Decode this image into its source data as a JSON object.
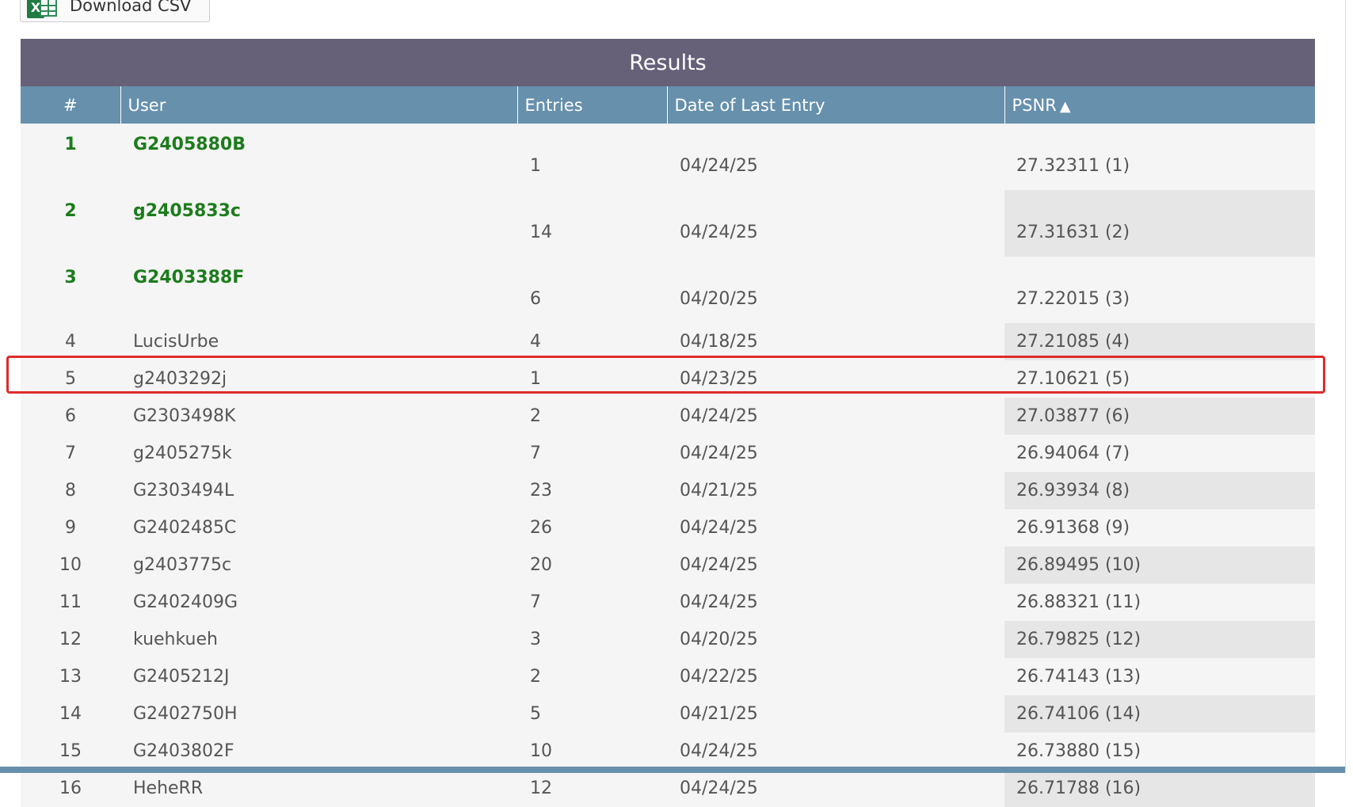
{
  "toolbar": {
    "download_label": "Download CSV"
  },
  "results": {
    "title": "Results",
    "columns": [
      "#",
      "User",
      "Entries",
      "Date of Last Entry",
      "PSNR"
    ],
    "sort_indicator": "▲",
    "rows": [
      {
        "rank": "1",
        "user": "G2405880B",
        "entries": "1",
        "date": "04/24/25",
        "psnr": "27.32311 (1)"
      },
      {
        "rank": "2",
        "user": "g2405833c",
        "entries": "14",
        "date": "04/24/25",
        "psnr": "27.31631 (2)"
      },
      {
        "rank": "3",
        "user": "G2403388F",
        "entries": "6",
        "date": "04/20/25",
        "psnr": "27.22015 (3)"
      },
      {
        "rank": "4",
        "user": "LucisUrbe",
        "entries": "4",
        "date": "04/18/25",
        "psnr": "27.21085 (4)"
      },
      {
        "rank": "5",
        "user": "g2403292j",
        "entries": "1",
        "date": "04/23/25",
        "psnr": "27.10621 (5)"
      },
      {
        "rank": "6",
        "user": "G2303498K",
        "entries": "2",
        "date": "04/24/25",
        "psnr": "27.03877 (6)"
      },
      {
        "rank": "7",
        "user": "g2405275k",
        "entries": "7",
        "date": "04/24/25",
        "psnr": "26.94064 (7)"
      },
      {
        "rank": "8",
        "user": "G2303494L",
        "entries": "23",
        "date": "04/21/25",
        "psnr": "26.93934 (8)"
      },
      {
        "rank": "9",
        "user": "G2402485C",
        "entries": "26",
        "date": "04/24/25",
        "psnr": "26.91368 (9)"
      },
      {
        "rank": "10",
        "user": "g2403775c",
        "entries": "20",
        "date": "04/24/25",
        "psnr": "26.89495 (10)"
      },
      {
        "rank": "11",
        "user": "G2402409G",
        "entries": "7",
        "date": "04/24/25",
        "psnr": "26.88321 (11)"
      },
      {
        "rank": "12",
        "user": "kuehkueh",
        "entries": "3",
        "date": "04/20/25",
        "psnr": "26.79825 (12)"
      },
      {
        "rank": "13",
        "user": "G2405212J",
        "entries": "2",
        "date": "04/22/25",
        "psnr": "26.74143 (13)"
      },
      {
        "rank": "14",
        "user": "G2402750H",
        "entries": "5",
        "date": "04/21/25",
        "psnr": "26.74106 (14)"
      },
      {
        "rank": "15",
        "user": "G2403802F",
        "entries": "10",
        "date": "04/24/25",
        "psnr": "26.73880 (15)"
      },
      {
        "rank": "16",
        "user": "HeheRR",
        "entries": "12",
        "date": "04/24/25",
        "psnr": "26.71788 (16)"
      }
    ]
  },
  "colors": {
    "title_bar": "#666178",
    "header_bar": "#6690ac",
    "top3_text": "#1c7c1c",
    "highlight": "#e02b2b"
  }
}
